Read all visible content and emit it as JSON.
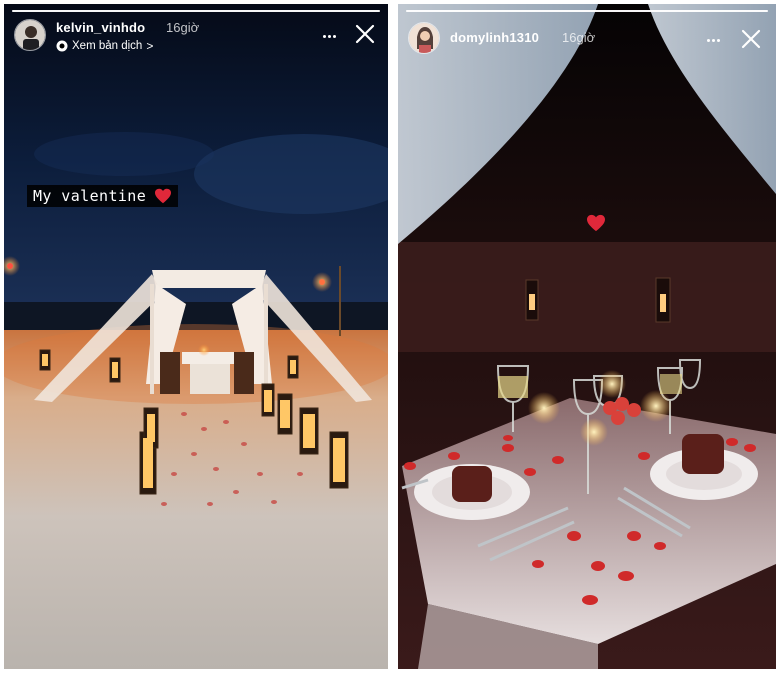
{
  "stories": [
    {
      "username": "kelvin_vinhdo",
      "time_ago": "16giờ",
      "translate_label": "Xem bản dịch",
      "translate_chevron": ">",
      "sticker_text": "My valentine",
      "progress_fraction": 1.0
    },
    {
      "username": "domylinh1310",
      "time_ago": "16giờ",
      "progress_fraction": 1.0
    }
  ],
  "icons": {
    "more": "more-horizontal-icon",
    "close": "close-icon",
    "heart": "heart-icon",
    "translate": "translate-icon"
  },
  "colors": {
    "heart_red": "#e0283a",
    "night_sky": "#0b1a33",
    "candle_glow": "#ffb347"
  }
}
